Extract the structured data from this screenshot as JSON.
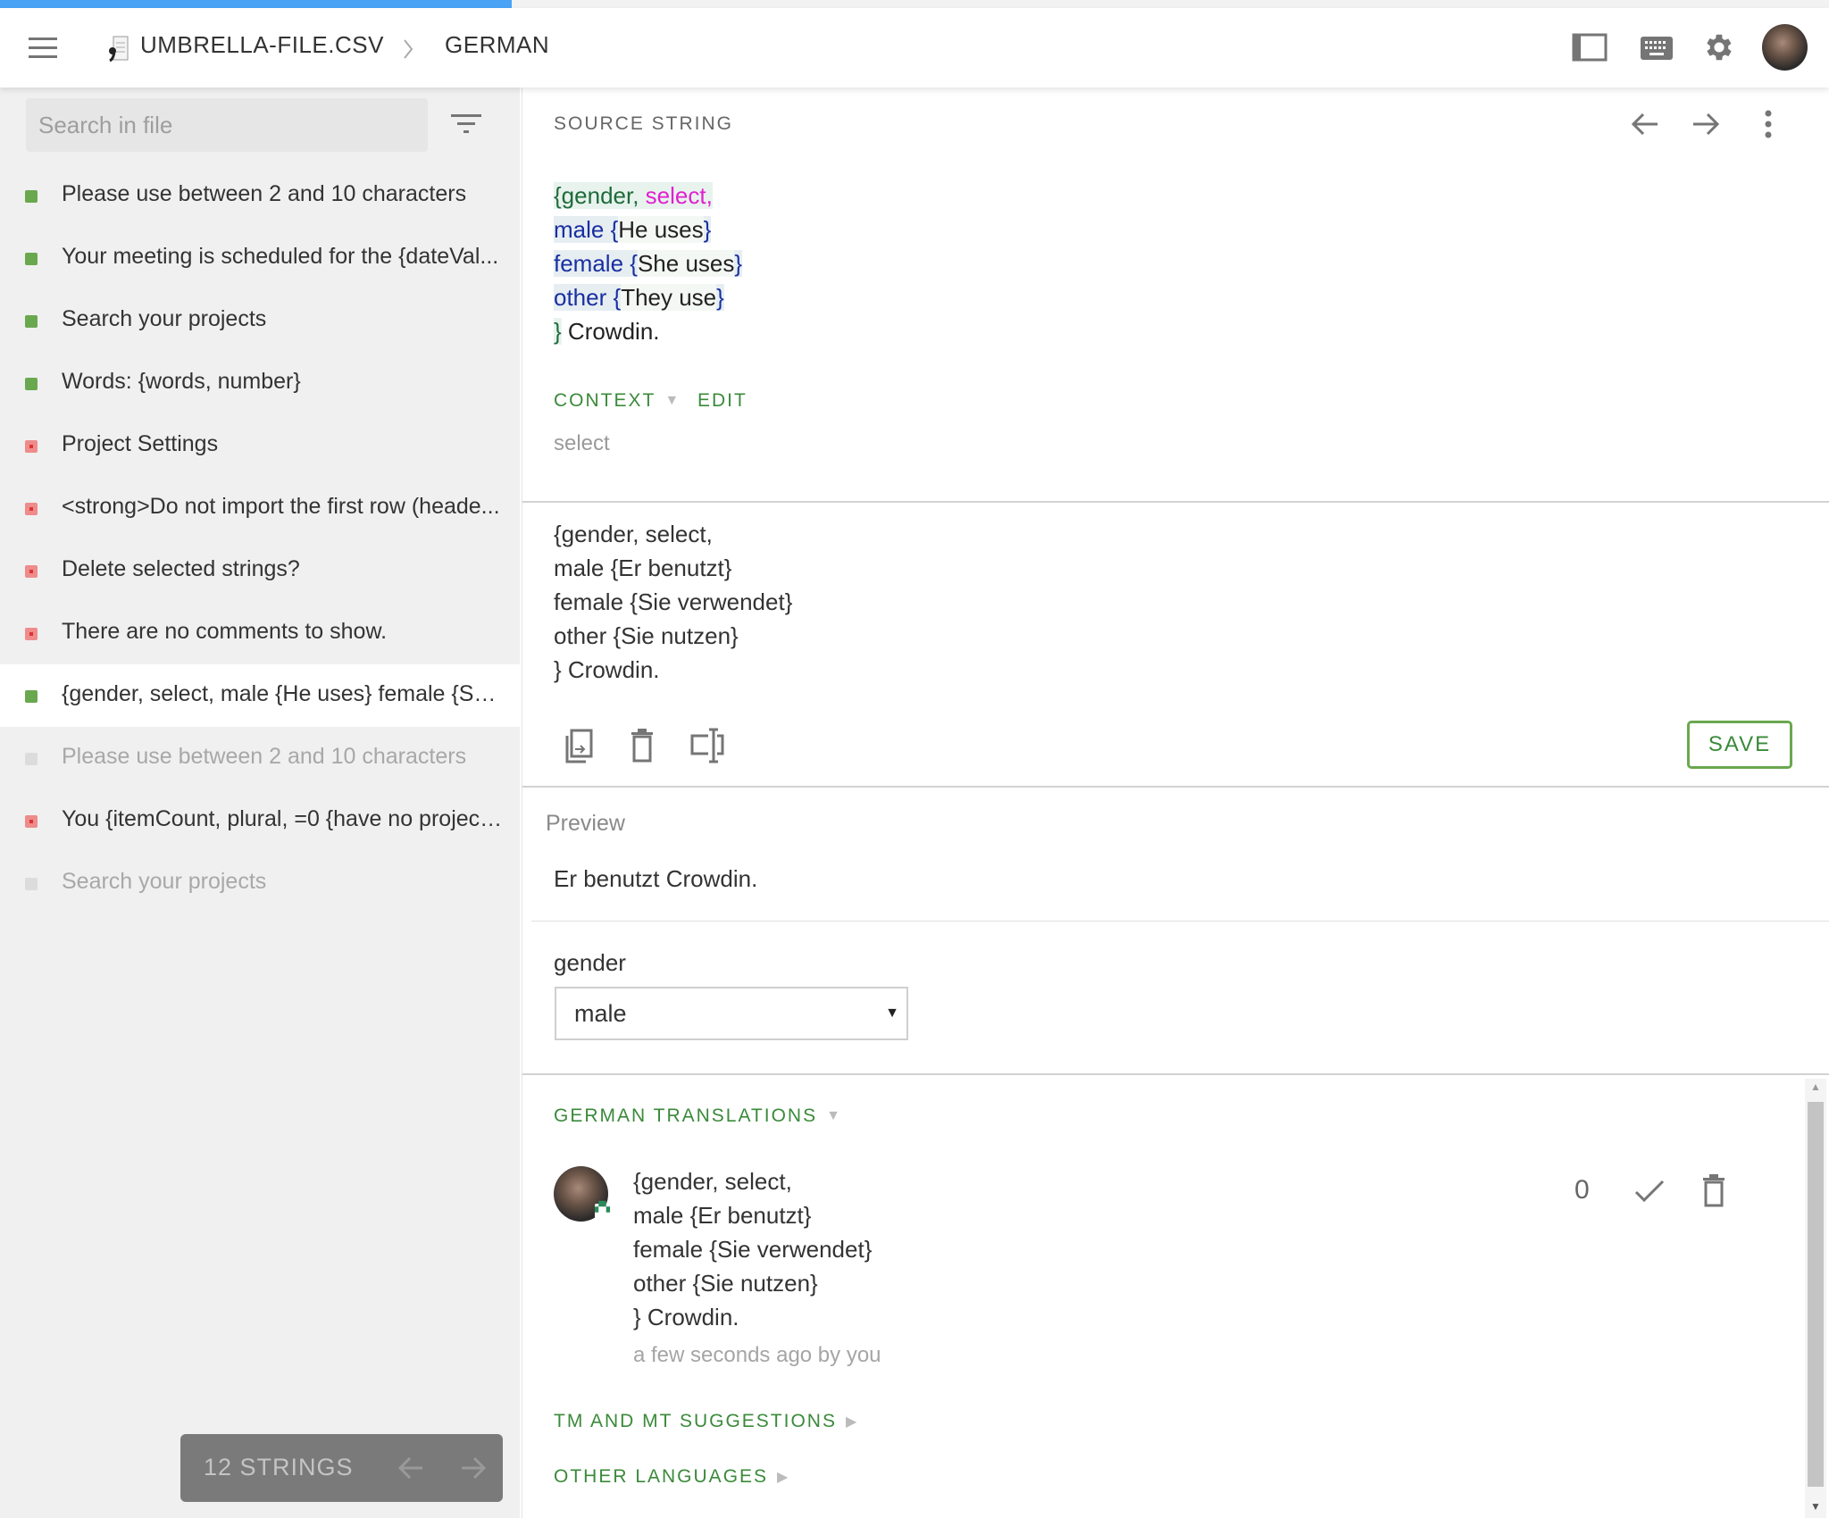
{
  "header": {
    "progress_percent": 28,
    "file_name": "UMBRELLA-FILE.CSV",
    "language": "GERMAN",
    "icons": [
      "menu-icon",
      "file-icon",
      "chevron-right-icon",
      "sidebar-toggle-icon",
      "keyboard-icon",
      "settings-icon",
      "user-avatar"
    ]
  },
  "sidebar": {
    "search_placeholder": "Search in file",
    "items": [
      {
        "text": "Please use between 2 and 10 characters",
        "status": "green"
      },
      {
        "text": "Your meeting is scheduled for the {dateVal...",
        "status": "green"
      },
      {
        "text": "Search your projects",
        "status": "green"
      },
      {
        "text": "Words: {words, number}",
        "status": "green"
      },
      {
        "text": "Project Settings",
        "status": "red"
      },
      {
        "text": "<strong>Do not import the first row (heade...",
        "status": "red"
      },
      {
        "text": "Delete selected strings?",
        "status": "red"
      },
      {
        "text": "There are no comments to show.",
        "status": "red"
      },
      {
        "text": "{gender, select, male {He uses} female {Sh...",
        "status": "green",
        "selected": true
      },
      {
        "text": "Please use between 2 and 10 characters",
        "status": "gray"
      },
      {
        "text": "You {itemCount, plural, =0 {have no project...",
        "status": "red"
      },
      {
        "text": "Search your projects",
        "status": "gray"
      }
    ],
    "count_label": "12 STRINGS"
  },
  "source": {
    "label": "SOURCE STRING",
    "lines": [
      [
        {
          "t": "{gender, ",
          "c": "kw"
        },
        {
          "t": "select,",
          "c": "sel"
        }
      ],
      [
        {
          "t": "male ",
          "c": "opt"
        },
        {
          "t": "{",
          "c": "br"
        },
        {
          "t": "He uses",
          "c": "txt"
        },
        {
          "t": "}",
          "c": "br"
        }
      ],
      [
        {
          "t": "female ",
          "c": "opt"
        },
        {
          "t": "{",
          "c": "br"
        },
        {
          "t": "She uses",
          "c": "txt"
        },
        {
          "t": "}",
          "c": "br"
        }
      ],
      [
        {
          "t": "other ",
          "c": "opt"
        },
        {
          "t": "{",
          "c": "br"
        },
        {
          "t": "They use",
          "c": "txt"
        },
        {
          "t": "}",
          "c": "br"
        }
      ],
      [
        {
          "t": "}",
          "c": "kw"
        },
        {
          "t": " Crowdin.",
          "c": "end"
        }
      ]
    ],
    "context_label": "CONTEXT",
    "edit_label": "EDIT",
    "context_value": "select"
  },
  "editor": {
    "lines": [
      "{gender, select,",
      "male {Er benutzt}",
      "female {Sie verwendet}",
      "other {Sie nutzen}",
      "} Crowdin."
    ],
    "save_label": "SAVE"
  },
  "preview": {
    "label": "Preview",
    "text": "Er benutzt Crowdin.",
    "param_label": "gender",
    "param_value": "male"
  },
  "translations": {
    "label": "GERMAN TRANSLATIONS",
    "items": [
      {
        "lines": [
          "{gender, select,",
          "male {Er benutzt}",
          "female {Sie verwendet}",
          "other {Sie nutzen}",
          "} Crowdin."
        ],
        "meta": "a few seconds ago by you",
        "votes": "0"
      }
    ],
    "tm_label": "TM AND MT SUGGESTIONS",
    "other_label": "OTHER LANGUAGES"
  },
  "colors": {
    "accent_green": "#3a8a3a",
    "progress_blue": "#4aa3f5",
    "status_green": "#6aa84f",
    "status_red": "#ef8b8b"
  }
}
